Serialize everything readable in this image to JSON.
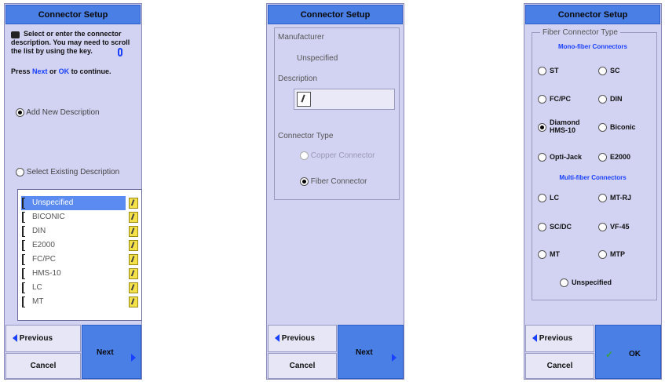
{
  "screens": [
    {
      "title": "Connector Setup",
      "instruction": "Select or enter the connector description. You may need to scroll the list by using the key.",
      "press_pre": "Press ",
      "press_next": "Next",
      "press_or": " or ",
      "press_ok": "OK",
      "press_post": " to continue.",
      "add_new_label": "Add New Description",
      "select_existing_label": "Select Existing Description",
      "list_items": [
        "Unspecified",
        "BICONIC",
        "DIN",
        "E2000",
        "FC/PC",
        "HMS-10",
        "LC",
        "MT"
      ],
      "selected_item": "Unspecified",
      "prev_label": "Previous",
      "cancel_label": "Cancel",
      "next_label": "Next"
    },
    {
      "title": "Connector Setup",
      "manufacturer_label": "Manufacturer",
      "manufacturer_value": "Unspecified",
      "description_label": "Description",
      "connector_type_label": "Connector Type",
      "copper_label": "Copper Connector",
      "fiber_label": "Fiber Connector",
      "prev_label": "Previous",
      "cancel_label": "Cancel",
      "next_label": "Next"
    },
    {
      "title": "Connector Setup",
      "group_label": "Fiber Connector Type",
      "mono_header": "Mono-fiber Connectors",
      "mono_options": [
        "ST",
        "SC",
        "FC/PC",
        "DIN",
        "Diamond HMS-10",
        "Biconic",
        "Opti-Jack",
        "E2000"
      ],
      "selected_option": "Diamond HMS-10",
      "multi_header": "Multi-fiber Connectors",
      "multi_options": [
        "LC",
        "MT-RJ",
        "SC/DC",
        "VF-45",
        "MT",
        "MTP"
      ],
      "unspecified_label": "Unspecified",
      "prev_label": "Previous",
      "cancel_label": "Cancel",
      "ok_label": "OK"
    }
  ],
  "colors": {
    "panel_bg": "#d2d2f2",
    "title_bg": "#4a7fe6",
    "accent_text": "#1a40ff",
    "list_selected": "#5b8bf0",
    "ok_check": "#3aa03a"
  }
}
